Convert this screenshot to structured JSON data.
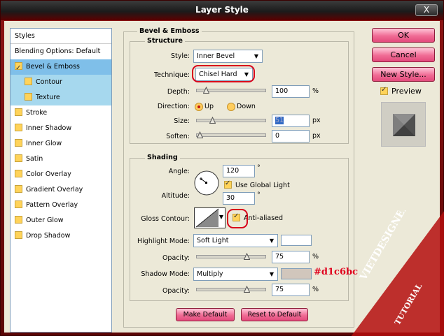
{
  "window": {
    "title": "Layer Style",
    "close_label": "X"
  },
  "sidebar": {
    "header": "Styles",
    "items": [
      {
        "label": "Blending Options: Default",
        "checkbox": false,
        "checked": false,
        "indent": false,
        "state": "normal"
      },
      {
        "label": "Bevel & Emboss",
        "checkbox": true,
        "checked": true,
        "indent": false,
        "state": "selected"
      },
      {
        "label": "Contour",
        "checkbox": true,
        "checked": false,
        "indent": true,
        "state": "subselected"
      },
      {
        "label": "Texture",
        "checkbox": true,
        "checked": false,
        "indent": true,
        "state": "subselected"
      },
      {
        "label": "Stroke",
        "checkbox": true,
        "checked": false,
        "indent": false,
        "state": "normal"
      },
      {
        "label": "Inner Shadow",
        "checkbox": true,
        "checked": false,
        "indent": false,
        "state": "normal"
      },
      {
        "label": "Inner Glow",
        "checkbox": true,
        "checked": false,
        "indent": false,
        "state": "normal"
      },
      {
        "label": "Satin",
        "checkbox": true,
        "checked": false,
        "indent": false,
        "state": "normal"
      },
      {
        "label": "Color Overlay",
        "checkbox": true,
        "checked": false,
        "indent": false,
        "state": "normal"
      },
      {
        "label": "Gradient Overlay",
        "checkbox": true,
        "checked": false,
        "indent": false,
        "state": "normal"
      },
      {
        "label": "Pattern Overlay",
        "checkbox": true,
        "checked": false,
        "indent": false,
        "state": "normal"
      },
      {
        "label": "Outer Glow",
        "checkbox": true,
        "checked": false,
        "indent": false,
        "state": "normal"
      },
      {
        "label": "Drop Shadow",
        "checkbox": true,
        "checked": false,
        "indent": false,
        "state": "normal"
      }
    ]
  },
  "bevel": {
    "section_title": "Bevel & Emboss",
    "structure": {
      "title": "Structure",
      "style_label": "Style:",
      "style_value": "Inner Bevel",
      "technique_label": "Technique:",
      "technique_value": "Chisel Hard",
      "depth_label": "Depth:",
      "depth_value": "100",
      "depth_unit": "%",
      "depth_level": 0.1,
      "direction_label": "Direction:",
      "dir_up": "Up",
      "dir_down": "Down",
      "direction_selected": "Up",
      "size_label": "Size:",
      "size_value": "51",
      "size_unit": "px",
      "size_level": 0.2,
      "soften_label": "Soften:",
      "soften_value": "0",
      "soften_unit": "px",
      "soften_level": 0.0
    },
    "shading": {
      "title": "Shading",
      "angle_label": "Angle:",
      "angle_value": "120",
      "angle_unit": "°",
      "use_global_light": "Use Global Light",
      "use_global_light_checked": true,
      "altitude_label": "Altitude:",
      "altitude_value": "30",
      "altitude_unit": "°",
      "gloss_contour_label": "Gloss Contour:",
      "anti_aliased": "Anti-aliased",
      "anti_aliased_checked": true,
      "highlight_mode_label": "Highlight Mode:",
      "highlight_mode_value": "Soft Light",
      "highlight_color": "#ffffff",
      "highlight_opacity_label": "Opacity:",
      "highlight_opacity_value": "75",
      "highlight_opacity_unit": "%",
      "highlight_opacity_level": 0.75,
      "shadow_mode_label": "Shadow Mode:",
      "shadow_mode_value": "Multiply",
      "shadow_color": "#d1c6bc",
      "shadow_color_annotation": "#d1c6bc",
      "shadow_opacity_label": "Opacity:",
      "shadow_opacity_value": "75",
      "shadow_opacity_unit": "%",
      "shadow_opacity_level": 0.75
    },
    "make_default": "Make Default",
    "reset_default": "Reset to Default"
  },
  "buttons": {
    "ok": "OK",
    "cancel": "Cancel",
    "new_style": "New Style...",
    "preview": "Preview",
    "preview_checked": true
  },
  "watermark": {
    "line1": "VIETDESIGNER.NET",
    "line2": "TUTORIAL"
  },
  "colors": {
    "accent_red": "#d8001a",
    "selected_item": "#7fbfe9",
    "subselected_item": "#a6d8ee",
    "button_pink": "#f06c95"
  }
}
